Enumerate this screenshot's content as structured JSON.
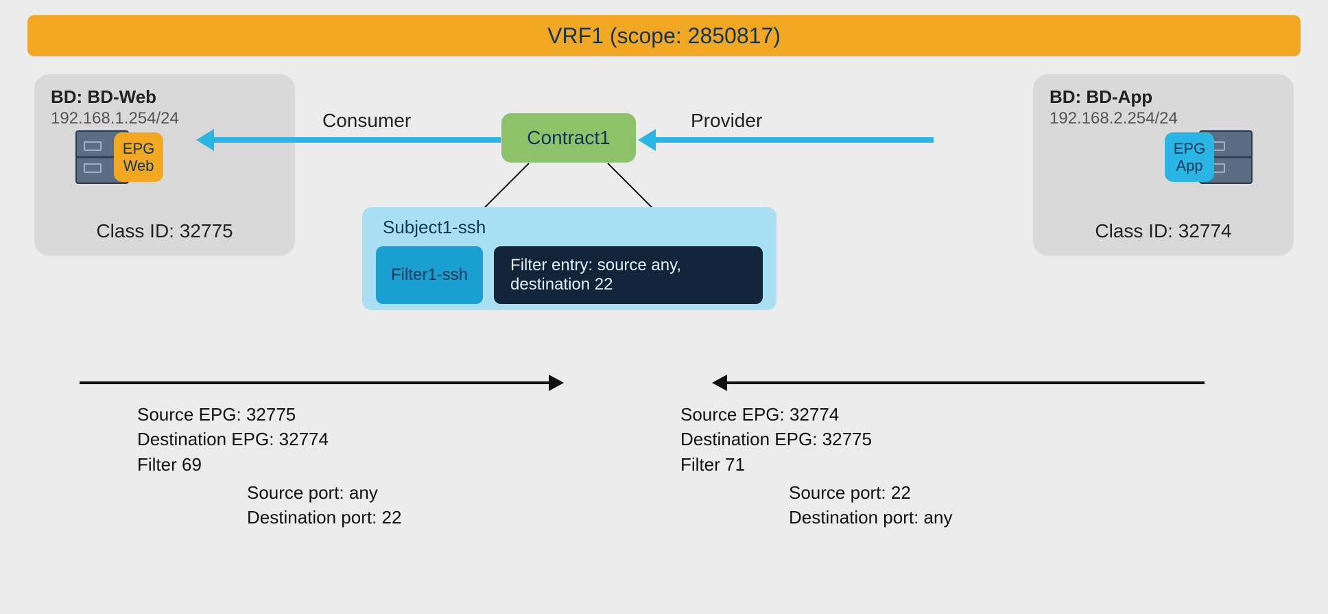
{
  "vrf": {
    "title": "VRF1 (scope: 2850817)"
  },
  "bd_left": {
    "title": "BD: BD-Web",
    "subnet": "192.168.1.254/24",
    "epg_line1": "EPG",
    "epg_line2": "Web",
    "class_id": "Class ID: 32775"
  },
  "bd_right": {
    "title": "BD: BD-App",
    "subnet": "192.168.2.254/24",
    "epg_line1": "EPG",
    "epg_line2": "App",
    "class_id": "Class ID: 32774"
  },
  "roles": {
    "consumer": "Consumer",
    "provider": "Provider"
  },
  "contract": {
    "name": "Contract1"
  },
  "subject": {
    "name": "Subject1-ssh",
    "filter_name": "Filter1-ssh",
    "filter_entry": "Filter entry: source any, destination 22"
  },
  "flow_left": {
    "l1": "Source EPG: 32775",
    "l2": "Destination EPG: 32774",
    "l3": "Filter 69",
    "p1": "Source port: any",
    "p2": "Destination port: 22"
  },
  "flow_right": {
    "l1": "Source EPG: 32774",
    "l2": "Destination EPG: 32775",
    "l3": "Filter 71",
    "p1": "Source port: 22",
    "p2": "Destination port: any"
  }
}
